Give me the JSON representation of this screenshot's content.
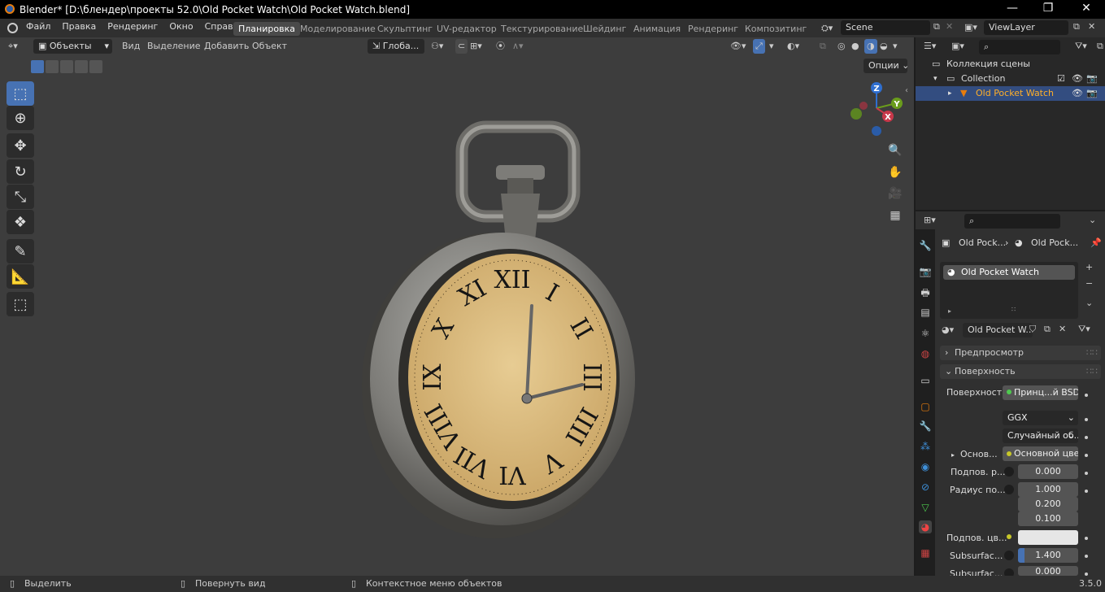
{
  "window": {
    "title": "Blender* [D:\\блендер\\проекты 52.0\\Old Pocket Watch\\Old Pocket Watch.blend]",
    "minimize": "—",
    "maximize": "❐",
    "close": "✕"
  },
  "menu": [
    "Файл",
    "Правка",
    "Рендеринг",
    "Окно",
    "Справка"
  ],
  "workspaces": [
    "Планировка",
    "Моделирование",
    "Скульптинг",
    "UV-редактор",
    "Текстурирование",
    "Шейдинг",
    "Анимация",
    "Рендеринг",
    "Композитинг"
  ],
  "active_workspace": "Планировка",
  "scene": "Scene",
  "view_layer": "ViewLayer",
  "viewport": {
    "mode": "Объекты",
    "menus": [
      "Вид",
      "Выделение",
      "Добавить",
      "Объект"
    ],
    "orientation": "Глоба...",
    "options": "Опции",
    "gizmo": {
      "x": "X",
      "y": "Y",
      "z": "Z"
    }
  },
  "outliner": {
    "scene_collection": "Коллекция сцены",
    "collection": "Collection",
    "object": "Old Pocket Watch"
  },
  "properties": {
    "breadcrumb": [
      "Old Pock...",
      "Old Pock..."
    ],
    "slot": "Old Pocket Watch",
    "material": "Old Pocket W...",
    "panel_preview": "Предпросмотр",
    "panel_surface": "Поверхность",
    "surface_label": "Поверхность",
    "surface_value": "Принц...й BSDF",
    "distribution": "GGX",
    "subsurface_method": "Случайный об...",
    "base_label": "Основ...",
    "base_value": "Основной цвет",
    "subsurface_label": "Подпов. р...",
    "subsurface_value": "0.000",
    "radius_label": "Радиус по...",
    "radius": [
      "1.000",
      "0.200",
      "0.100"
    ],
    "subsurface_color_label": "Подпов. цв...",
    "subsurface_ior_label": "Subsurfac...",
    "subsurface_ior": "1.400",
    "subsurface_aniso_label": "Subsurfac...",
    "subsurface_aniso": "0.000"
  },
  "watch": {
    "numerals": [
      "XII",
      "I",
      "II",
      "III",
      "IIII",
      "V",
      "VI",
      "VII",
      "VIII",
      "IX",
      "X",
      "XI"
    ]
  },
  "status": {
    "select": "Выделить",
    "rotate": "Повернуть вид",
    "context": "Контекстное меню объектов",
    "version": "3.5.0"
  },
  "colors": {
    "accent": "#4772b3",
    "orange": "#e87d0d",
    "viewport_bg": "#3d3d3d",
    "dial": "#d9b878"
  }
}
